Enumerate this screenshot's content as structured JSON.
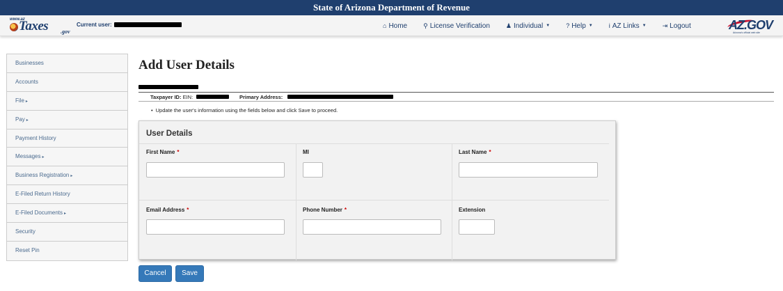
{
  "banner": {
    "title": "State of Arizona Department of Revenue"
  },
  "header": {
    "logo": {
      "www": "www.az",
      "word": "Taxes",
      "gov": ".gov"
    },
    "current_user_label": "Current user:",
    "nav": [
      {
        "label": "Home",
        "icon": "home-icon",
        "glyph": "⌂"
      },
      {
        "label": "License Verification",
        "icon": "search-icon",
        "glyph": "⚲"
      },
      {
        "label": "Individual",
        "icon": "user-icon",
        "glyph": "♟",
        "dropdown": true
      },
      {
        "label": "Help",
        "icon": "question-icon",
        "glyph": "?",
        "dropdown": true
      },
      {
        "label": "AZ Links",
        "icon": "info-icon",
        "glyph": "i",
        "dropdown": true
      },
      {
        "label": "Logout",
        "icon": "logout-icon",
        "glyph": "⇥"
      }
    ],
    "azgov": {
      "text": "AZ.GOV",
      "tagline": "Arizona's official web site"
    }
  },
  "sidebar": {
    "items": [
      {
        "label": "Businesses",
        "submenu": false
      },
      {
        "label": "Accounts",
        "submenu": false
      },
      {
        "label": "File",
        "submenu": true
      },
      {
        "label": "Pay",
        "submenu": true
      },
      {
        "label": "Payment History",
        "submenu": false
      },
      {
        "label": "Messages",
        "submenu": true
      },
      {
        "label": "Business Registration",
        "submenu": true
      },
      {
        "label": "E-Filed Return History",
        "submenu": false
      },
      {
        "label": "E-Filed Documents",
        "submenu": true
      },
      {
        "label": "Security",
        "submenu": false
      },
      {
        "label": "Reset Pin",
        "submenu": false
      }
    ]
  },
  "main": {
    "title": "Add User Details",
    "taxpayer_label": "Taxpayer ID:",
    "taxpayer_type": "EIN:",
    "primary_address_label": "Primary Address:",
    "instruction": "Update the user's information using the fields below and click Save to proceed."
  },
  "form": {
    "title": "User Details",
    "first_name": {
      "label": "First Name",
      "required": "*",
      "value": ""
    },
    "mi": {
      "label": "MI",
      "value": ""
    },
    "last_name": {
      "label": "Last Name",
      "required": "*",
      "value": ""
    },
    "email": {
      "label": "Email Address",
      "required": "*",
      "value": ""
    },
    "phone": {
      "label": "Phone Number",
      "required": "*",
      "value": ""
    },
    "extension": {
      "label": "Extension",
      "value": ""
    }
  },
  "actions": {
    "cancel": "Cancel",
    "save": "Save"
  },
  "colors": {
    "brand_navy": "#1f3f6e",
    "button_blue": "#3579b9",
    "required_red": "#cc0000"
  }
}
